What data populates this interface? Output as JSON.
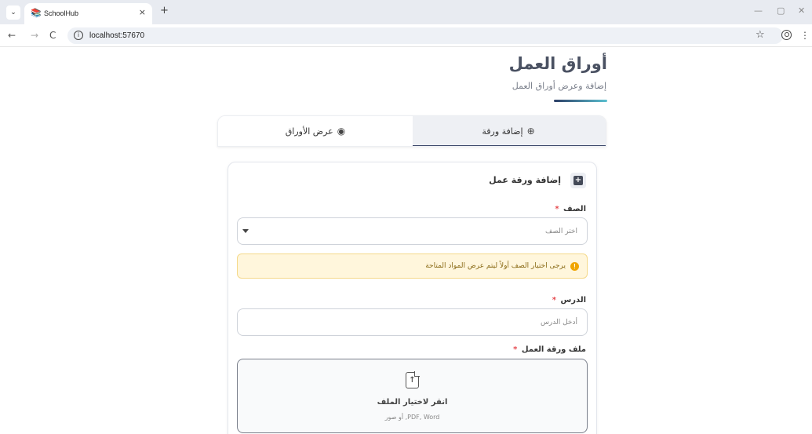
{
  "browser": {
    "tab_title": "SchoolHub",
    "tab_close": "×",
    "new_tab": "+",
    "url": "localhost:57670",
    "minimize": "—",
    "restore": "▢",
    "close": "✕",
    "back": "←",
    "forward": "→",
    "reload": "C"
  },
  "header": {
    "title": "أوراق العمل",
    "subtitle": "إضافة وعرض أوراق العمل"
  },
  "tabs": {
    "add_label": "إضافة ورقة",
    "view_label": "عرض الأوراق",
    "active": "add"
  },
  "form": {
    "card_title": "إضافة ورقة عمل",
    "grade_label": "الصف",
    "grade_value": "اختر الصف",
    "notice": "يرجى اختيار الصف أولاً ليتم عرض المواد المتاحة",
    "lesson_label": "الدرس",
    "lesson_placeholder": "أدخل الدرس",
    "file_label": "ملف ورقة العمل",
    "required_mark": "*",
    "dropzone_title": "انقر لاختيار الملف",
    "dropzone_hint": "PDF, Word, أو صور"
  },
  "colors": {
    "accent": "#3d4a6b",
    "accent_gradient_end": "#5bc0d0",
    "required": "#e5484d",
    "notice_bg": "#fff6dc",
    "notice_icon": "#f0a500"
  },
  "icons": {
    "plus_circle": "⊕",
    "eye": "👁"
  }
}
